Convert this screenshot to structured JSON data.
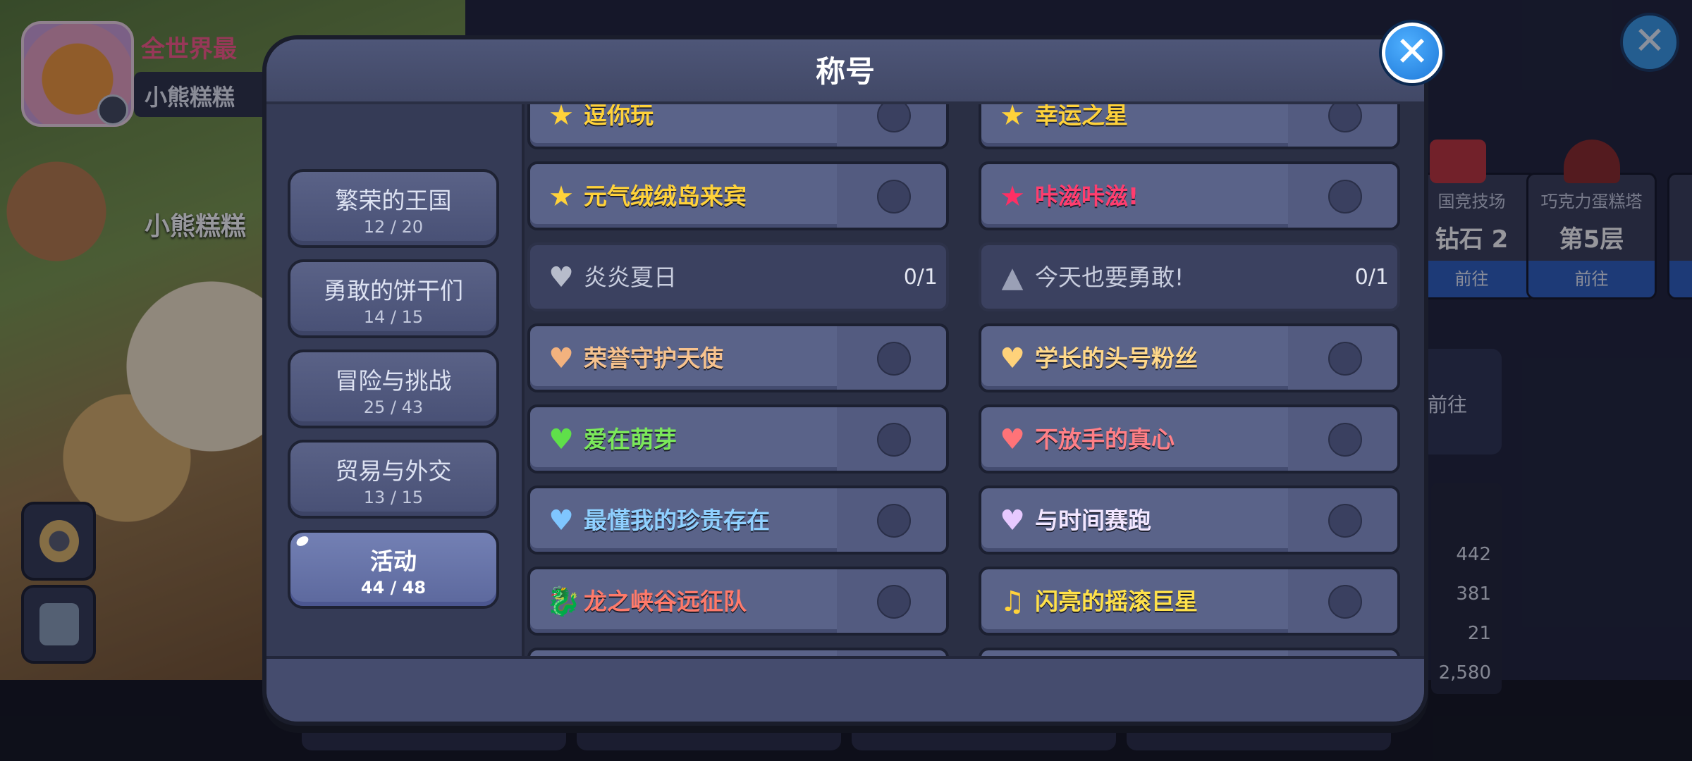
{
  "background": {
    "profile_title": "全世界最",
    "profile_name": "小熊糕糕",
    "floating_name": "小熊糕糕",
    "cards": [
      {
        "caption": "国竞技场",
        "value": "钻石 2",
        "button": "前往"
      },
      {
        "caption": "巧克力蛋糕塔",
        "value": "第5层",
        "button": "前往"
      }
    ],
    "go_label": "前往",
    "stats": [
      "442",
      "381",
      "21",
      "2,580"
    ]
  },
  "modal": {
    "title": "称号",
    "close_icon": "close-icon",
    "categories": [
      {
        "name": "繁荣的王国",
        "count": "12 / 20",
        "active": false
      },
      {
        "name": "勇敢的饼干们",
        "count": "14 / 15",
        "active": false
      },
      {
        "name": "冒险与挑战",
        "count": "25 / 43",
        "active": false
      },
      {
        "name": "贸易与外交",
        "count": "13 / 15",
        "active": false
      },
      {
        "name": "活动",
        "count": "44 / 48",
        "active": true
      }
    ],
    "titles_left": [
      {
        "label": "逗你玩",
        "icon": "star-icon",
        "glyph": "★",
        "color": "#ffd23a",
        "icon_color": "#ffd23a"
      },
      {
        "label": "元气绒绒岛来宾",
        "icon": "star-icon",
        "glyph": "★",
        "color": "#ffd23a",
        "icon_color": "#ffd23a"
      },
      {
        "label": "炎炎夏日",
        "icon": "heart-icon",
        "glyph": "♥",
        "color": "#c7ccdd",
        "icon_color": "#b7bccb",
        "progress": "0/1",
        "locked": true
      },
      {
        "label": "荣誉守护天使",
        "icon": "heart-icon",
        "glyph": "♥",
        "color": "#f6c28e",
        "icon_color": "#f3b27e"
      },
      {
        "label": "爱在萌芽",
        "icon": "heart-icon",
        "glyph": "♥",
        "color": "#7be85a",
        "icon_color": "#5fe04a"
      },
      {
        "label": "最懂我的珍贵存在",
        "icon": "heart-icon",
        "glyph": "♥",
        "color": "#8fd0ff",
        "icon_color": "#7fc6ff"
      },
      {
        "label": "龙之峡谷远征队",
        "icon": "dragon-icon",
        "glyph": "🐉",
        "color": "#ff7a6a",
        "icon_color": "#ff5c4a"
      }
    ],
    "titles_right": [
      {
        "label": "幸运之星",
        "icon": "star-icon",
        "glyph": "★",
        "color": "#ffd23a",
        "icon_color": "#ffd23a"
      },
      {
        "label": "咔滋咔滋!",
        "icon": "star-icon",
        "glyph": "★",
        "color": "#ff3d6e",
        "icon_color": "#ff2f64"
      },
      {
        "label": "今天也要勇敢!",
        "icon": "party-hat-icon",
        "glyph": "▲",
        "color": "#c7ccdd",
        "icon_color": "#9aa0b6",
        "progress": "0/1",
        "locked": true
      },
      {
        "label": "学长的头号粉丝",
        "icon": "heart-icon",
        "glyph": "♥",
        "color": "#ffd88a",
        "icon_color": "#ffd27a"
      },
      {
        "label": "不放手的真心",
        "icon": "heart-icon",
        "glyph": "♥",
        "color": "#ff7f86",
        "icon_color": "#ff7378"
      },
      {
        "label": "与时间赛跑",
        "icon": "heart-icon",
        "glyph": "♥",
        "color": "#f2e6ff",
        "icon_color": "#e7c9ff"
      },
      {
        "label": "闪亮的摇滚巨星",
        "icon": "music-note-icon",
        "glyph": "♫",
        "color": "#ffe14a",
        "icon_color": "#ffd23a"
      }
    ]
  }
}
